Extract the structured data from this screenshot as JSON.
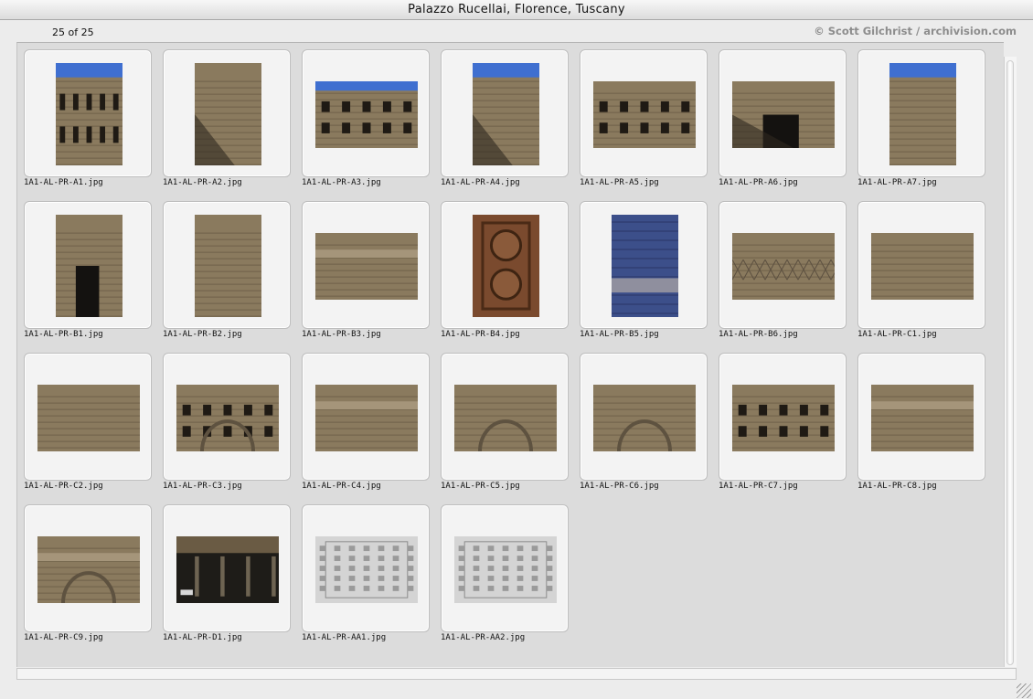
{
  "window": {
    "title": "Palazzo Rucellai, Florence, Tuscany"
  },
  "info": {
    "count": "25 of 25",
    "credit": "© Scott Gilchrist / archivision.com"
  },
  "images": [
    {
      "name": "1A1-AL-PR-A1.jpg",
      "orientation": "portrait",
      "scene": "facade-street"
    },
    {
      "name": "1A1-AL-PR-A2.jpg",
      "orientation": "portrait",
      "scene": "facade-shadow"
    },
    {
      "name": "1A1-AL-PR-A3.jpg",
      "orientation": "landscape",
      "scene": "facade-upward"
    },
    {
      "name": "1A1-AL-PR-A4.jpg",
      "orientation": "portrait",
      "scene": "facade-corner"
    },
    {
      "name": "1A1-AL-PR-A5.jpg",
      "orientation": "landscape",
      "scene": "facade-windows"
    },
    {
      "name": "1A1-AL-PR-A6.jpg",
      "orientation": "landscape",
      "scene": "facade-door"
    },
    {
      "name": "1A1-AL-PR-A7.jpg",
      "orientation": "portrait",
      "scene": "facade-street-light"
    },
    {
      "name": "1A1-AL-PR-B1.jpg",
      "orientation": "portrait",
      "scene": "portal"
    },
    {
      "name": "1A1-AL-PR-B2.jpg",
      "orientation": "portrait",
      "scene": "pilaster-detail"
    },
    {
      "name": "1A1-AL-PR-B3.jpg",
      "orientation": "landscape",
      "scene": "cornice-detail"
    },
    {
      "name": "1A1-AL-PR-B4.jpg",
      "orientation": "portrait",
      "scene": "door-rosettes"
    },
    {
      "name": "1A1-AL-PR-B5.jpg",
      "orientation": "portrait",
      "scene": "bench-wall"
    },
    {
      "name": "1A1-AL-PR-B6.jpg",
      "orientation": "landscape",
      "scene": "reticulated-base"
    },
    {
      "name": "1A1-AL-PR-C1.jpg",
      "orientation": "landscape",
      "scene": "rusticated-blocks"
    },
    {
      "name": "1A1-AL-PR-C2.jpg",
      "orientation": "landscape",
      "scene": "wall-window"
    },
    {
      "name": "1A1-AL-PR-C3.jpg",
      "orientation": "landscape",
      "scene": "windows-arched"
    },
    {
      "name": "1A1-AL-PR-C4.jpg",
      "orientation": "landscape",
      "scene": "entablature"
    },
    {
      "name": "1A1-AL-PR-C5.jpg",
      "orientation": "landscape",
      "scene": "window-arch"
    },
    {
      "name": "1A1-AL-PR-C6.jpg",
      "orientation": "landscape",
      "scene": "arch-crest"
    },
    {
      "name": "1A1-AL-PR-C7.jpg",
      "orientation": "landscape",
      "scene": "capitals"
    },
    {
      "name": "1A1-AL-PR-C8.jpg",
      "orientation": "landscape",
      "scene": "cornice-capital"
    },
    {
      "name": "1A1-AL-PR-C9.jpg",
      "orientation": "landscape",
      "scene": "arch-cornice"
    },
    {
      "name": "1A1-AL-PR-D1.jpg",
      "orientation": "landscape",
      "scene": "courtyard"
    },
    {
      "name": "1A1-AL-PR-AA1.jpg",
      "orientation": "landscape",
      "scene": "drawing-elevation"
    },
    {
      "name": "1A1-AL-PR-AA2.jpg",
      "orientation": "landscape",
      "scene": "drawing-detail"
    }
  ],
  "colors": {
    "stone": "#8a7a5e",
    "stone_dark": "#4a3f2e",
    "sky": "#3f6fd0",
    "drawing": "#d4d4d4"
  }
}
